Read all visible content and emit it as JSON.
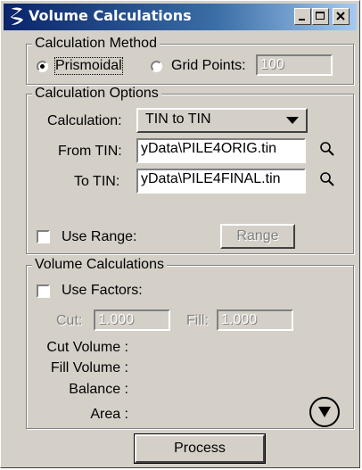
{
  "window": {
    "title": "Volume Calculations"
  },
  "titlebar_buttons": {
    "minimize": "minimize-icon",
    "maximize": "maximize-icon",
    "close": "close-icon"
  },
  "calc_method": {
    "legend": "Calculation Method",
    "prismoidal_label": "Prismoidal",
    "prismoidal_selected": true,
    "grid_label": "Grid Points:",
    "grid_value": "100"
  },
  "calc_options": {
    "legend": "Calculation Options",
    "calculation_label": "Calculation:",
    "calculation_value": "TIN to TIN",
    "from_label": "From TIN:",
    "from_value": "yData\\PILE4ORIG.tin",
    "to_label": "To TIN:",
    "to_value": "yData\\PILE4FINAL.tin",
    "use_range_label": "Use Range:",
    "range_button": "Range"
  },
  "volume": {
    "legend": "Volume Calculations",
    "use_factors_label": "Use Factors:",
    "cut_label": "Cut:",
    "cut_value": "1.000",
    "fill_label": "Fill:",
    "fill_value": "1.000",
    "cut_volume_label": "Cut Volume :",
    "fill_volume_label": "Fill Volume :",
    "balance_label": "Balance :",
    "area_label": "Area :"
  },
  "process_button": "Process"
}
